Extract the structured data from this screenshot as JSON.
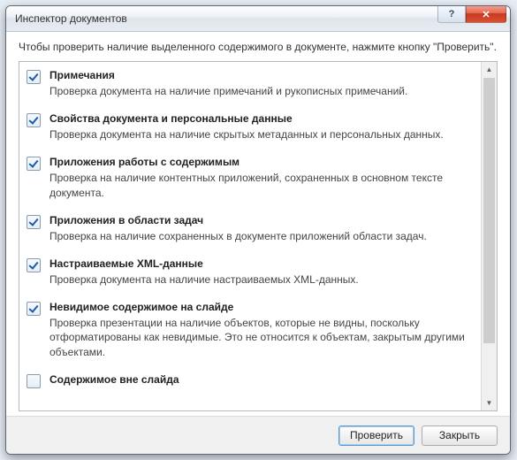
{
  "window": {
    "title": "Инспектор документов"
  },
  "instruction": "Чтобы проверить наличие выделенного содержимого в документе, нажмите кнопку \"Проверить\".",
  "items": [
    {
      "checked": true,
      "title": "Примечания",
      "desc": "Проверка документа на наличие примечаний и рукописных примечаний."
    },
    {
      "checked": true,
      "title": "Свойства документа и персональные данные",
      "desc": "Проверка документа на наличие скрытых метаданных и персональных данных."
    },
    {
      "checked": true,
      "title": "Приложения работы с содержимым",
      "desc": "Проверка на наличие контентных приложений, сохраненных в основном тексте документа."
    },
    {
      "checked": true,
      "title": "Приложения в области задач",
      "desc": "Проверка на наличие сохраненных в документе приложений области задач."
    },
    {
      "checked": true,
      "title": "Настраиваемые XML-данные",
      "desc": "Проверка документа на наличие настраиваемых XML-данных."
    },
    {
      "checked": true,
      "title": "Невидимое содержимое на слайде",
      "desc": "Проверка презентации на наличие объектов, которые не видны, поскольку отформатированы как невидимые. Это не относится к объектам, закрытым другими объектами."
    },
    {
      "checked": false,
      "title": "Содержимое вне слайда",
      "desc": ""
    }
  ],
  "buttons": {
    "inspect": "Проверить",
    "close": "Закрыть"
  },
  "glyphs": {
    "help": "?",
    "close_x": "✕",
    "up": "▲",
    "down": "▼"
  }
}
